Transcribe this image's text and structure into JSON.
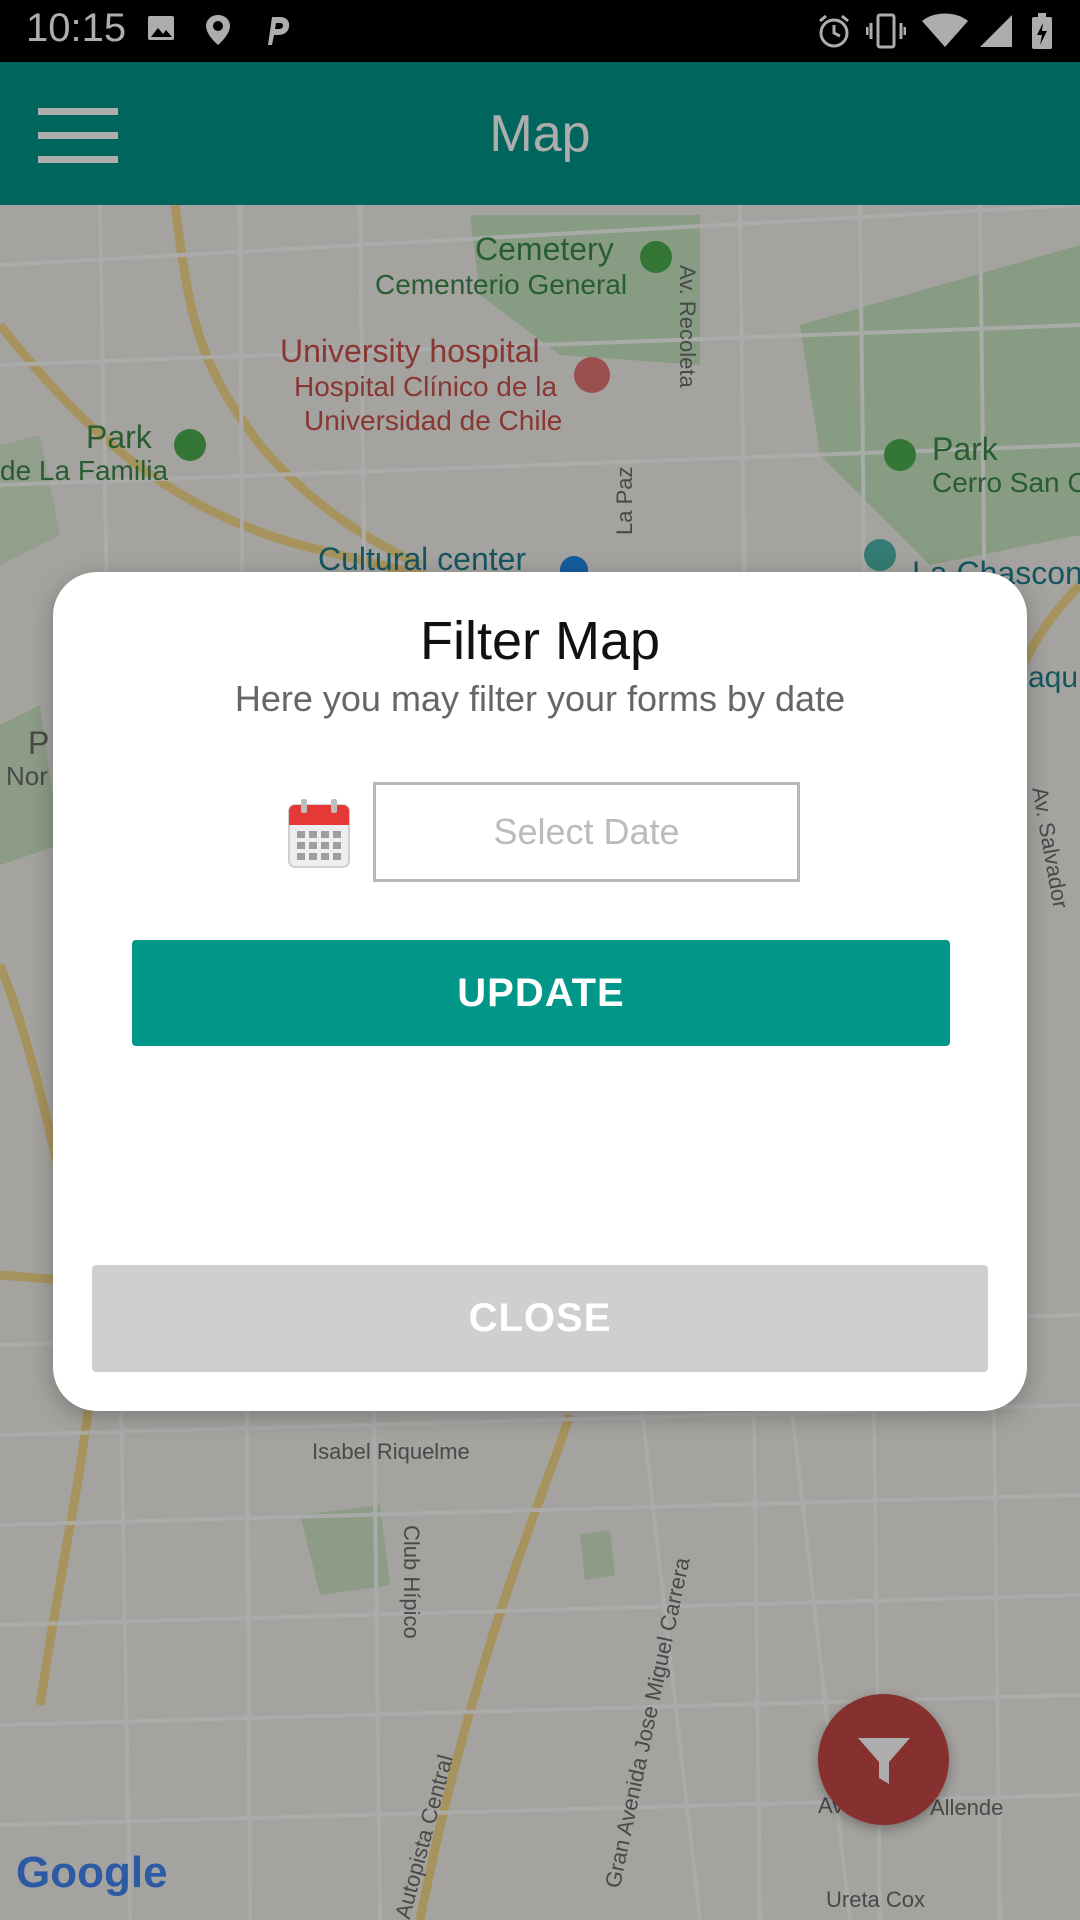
{
  "status_bar": {
    "time": "10:15"
  },
  "app_bar": {
    "title": "Map"
  },
  "map": {
    "labels": {
      "cemetery": "Cemetery",
      "cementerio": "Cementerio General",
      "university_hospital": "University hospital",
      "hospital_clinico": "Hospital Clínico de la",
      "universidad": "Universidad de Chile",
      "park_left": "Park",
      "la_familia": "de La Familia",
      "park_right": "Park",
      "cerro_san": "Cerro San Cr",
      "cultural_center": "Cultural center",
      "la_chascona": "La Chascon",
      "av_recoleta": "Av. Recoleta",
      "la_paz": "La Paz",
      "isabel_riquelme": "Isabel Riquelme",
      "club_hipico": "Club Hípico",
      "gran_avenida": "Gran Avenida Jose Miguel Carrera",
      "autopista_central": "Autopista Central",
      "av_salvador": "Av. Salvador",
      "allende": "Allende",
      "ureta_cox": "Ureta Cox",
      "left_p": "P",
      "left_nor": "Nor",
      "right_aqu": "aqu",
      "av_partial": "Av"
    },
    "attribution": "Google"
  },
  "dialog": {
    "title": "Filter Map",
    "subtitle": "Here you may filter your forms by date",
    "date_placeholder": "Select Date",
    "update_label": "UPDATE",
    "close_label": "CLOSE"
  },
  "colors": {
    "primary": "#009688",
    "fab": "#c84747",
    "close_button": "#cfcfcf"
  },
  "icons": {
    "menu": "hamburger-menu-icon",
    "calendar": "calendar-icon",
    "filter": "filter-funnel-icon"
  }
}
